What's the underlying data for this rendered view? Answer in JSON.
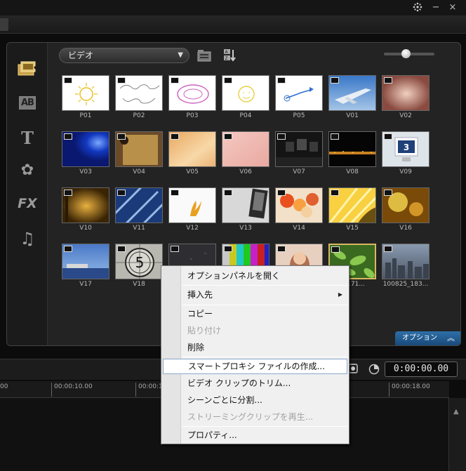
{
  "window": {
    "settings_icon": "gear-icon",
    "minimize_glyph": "−",
    "close_glyph": "×"
  },
  "library": {
    "folder_select_value": "ビデオ",
    "option_button_label": "オプション",
    "sidebar": [
      "media-icon",
      "transition-icon",
      "title-icon",
      "graphic-icon",
      "fx-icon",
      "audio-icon"
    ],
    "sidebar_text": {
      "transition": "AB",
      "title": "T",
      "fx": "FX",
      "audio": "♫",
      "graphic": "✿"
    },
    "clips": [
      {
        "label": "P01",
        "kind": "sketch-sun"
      },
      {
        "label": "P02",
        "kind": "sketch-map"
      },
      {
        "label": "P03",
        "kind": "sketch-pink"
      },
      {
        "label": "P04",
        "kind": "sketch-yellow"
      },
      {
        "label": "P05",
        "kind": "sketch-arrow"
      },
      {
        "label": "V01",
        "kind": "sky-plane"
      },
      {
        "label": "V02",
        "kind": "soft-pink"
      },
      {
        "label": "V03",
        "kind": "blue-light"
      },
      {
        "label": "V04",
        "kind": "parchment"
      },
      {
        "label": "V05",
        "kind": "peach"
      },
      {
        "label": "V06",
        "kind": "blush"
      },
      {
        "label": "V07",
        "kind": "dark-screens"
      },
      {
        "label": "V08",
        "kind": "night-city"
      },
      {
        "label": "V09",
        "kind": "monitor-3"
      },
      {
        "label": "V10",
        "kind": "golden-film"
      },
      {
        "label": "V11",
        "kind": "blue-streaks"
      },
      {
        "label": "V12",
        "kind": "splash"
      },
      {
        "label": "V13",
        "kind": "photo-gray"
      },
      {
        "label": "V14",
        "kind": "balloons"
      },
      {
        "label": "V15",
        "kind": "yellow-rays"
      },
      {
        "label": "V16",
        "kind": "gold-bokeh"
      },
      {
        "label": "V17",
        "kind": "seaside"
      },
      {
        "label": "V18",
        "kind": "countdown"
      },
      {
        "label": "",
        "kind": "dark-noise"
      },
      {
        "label": "",
        "kind": "color-bars"
      },
      {
        "label": "",
        "kind": "portrait"
      },
      {
        "label": "5_171...",
        "kind": "green-leaves"
      },
      {
        "label": "100825_183...",
        "kind": "cityscape"
      }
    ],
    "countdown_digit": "5",
    "monitor_digit": "3"
  },
  "timeline": {
    "timecode": "0:00:00.00",
    "ruler_ticks": [
      "00",
      "00:00:10.00",
      "00:00:1",
      "00:00:18.00"
    ]
  },
  "context_menu": {
    "items": [
      {
        "label": "オプションパネルを開く",
        "enabled": true
      },
      {
        "label": "挿入先",
        "enabled": true,
        "submenu": true
      },
      {
        "label": "コピー",
        "enabled": true
      },
      {
        "label": "貼り付け",
        "enabled": false
      },
      {
        "label": "削除",
        "enabled": true
      },
      {
        "label": "スマートプロキシ ファイルの作成...",
        "enabled": true,
        "highlighted": true
      },
      {
        "label": "ビデオ クリップのトリム...",
        "enabled": true
      },
      {
        "label": "シーンごとに分割...",
        "enabled": true
      },
      {
        "label": "ストリーミングクリップを再生...",
        "enabled": false
      },
      {
        "label": "プロパティ...",
        "enabled": true
      }
    ]
  },
  "colors": {
    "accent_option": "#2f6fa8",
    "selection_border": "#d8b860",
    "menu_highlight_border": "#8aa8cc"
  }
}
